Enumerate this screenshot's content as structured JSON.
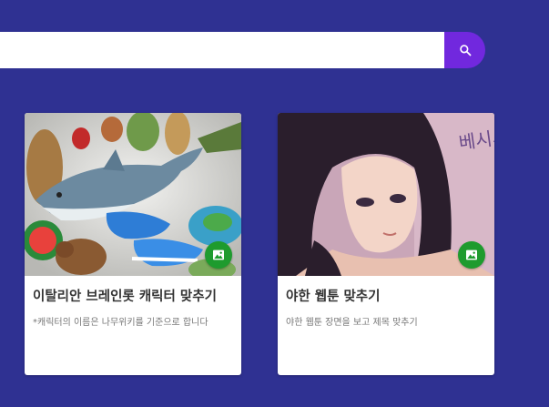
{
  "theme": {
    "background": "#2f3192",
    "accent": "#7128de",
    "badge_color": "#1e9b2e"
  },
  "search": {
    "value": "",
    "placeholder": "",
    "button_icon": "search-icon"
  },
  "cards": [
    {
      "title": "이탈리안 브레인롯 캐릭터 맞추기",
      "description": "*캐릭터의 이름은 나무위키를 기준으로 합니다",
      "badge_icon": "image-icon"
    },
    {
      "title": "야한 웹툰 맞추기",
      "description": "야한 웹툰 장면을 보고 제목 맞추기",
      "badge_icon": "image-icon",
      "thumbnail_text": "베시시.."
    }
  ]
}
